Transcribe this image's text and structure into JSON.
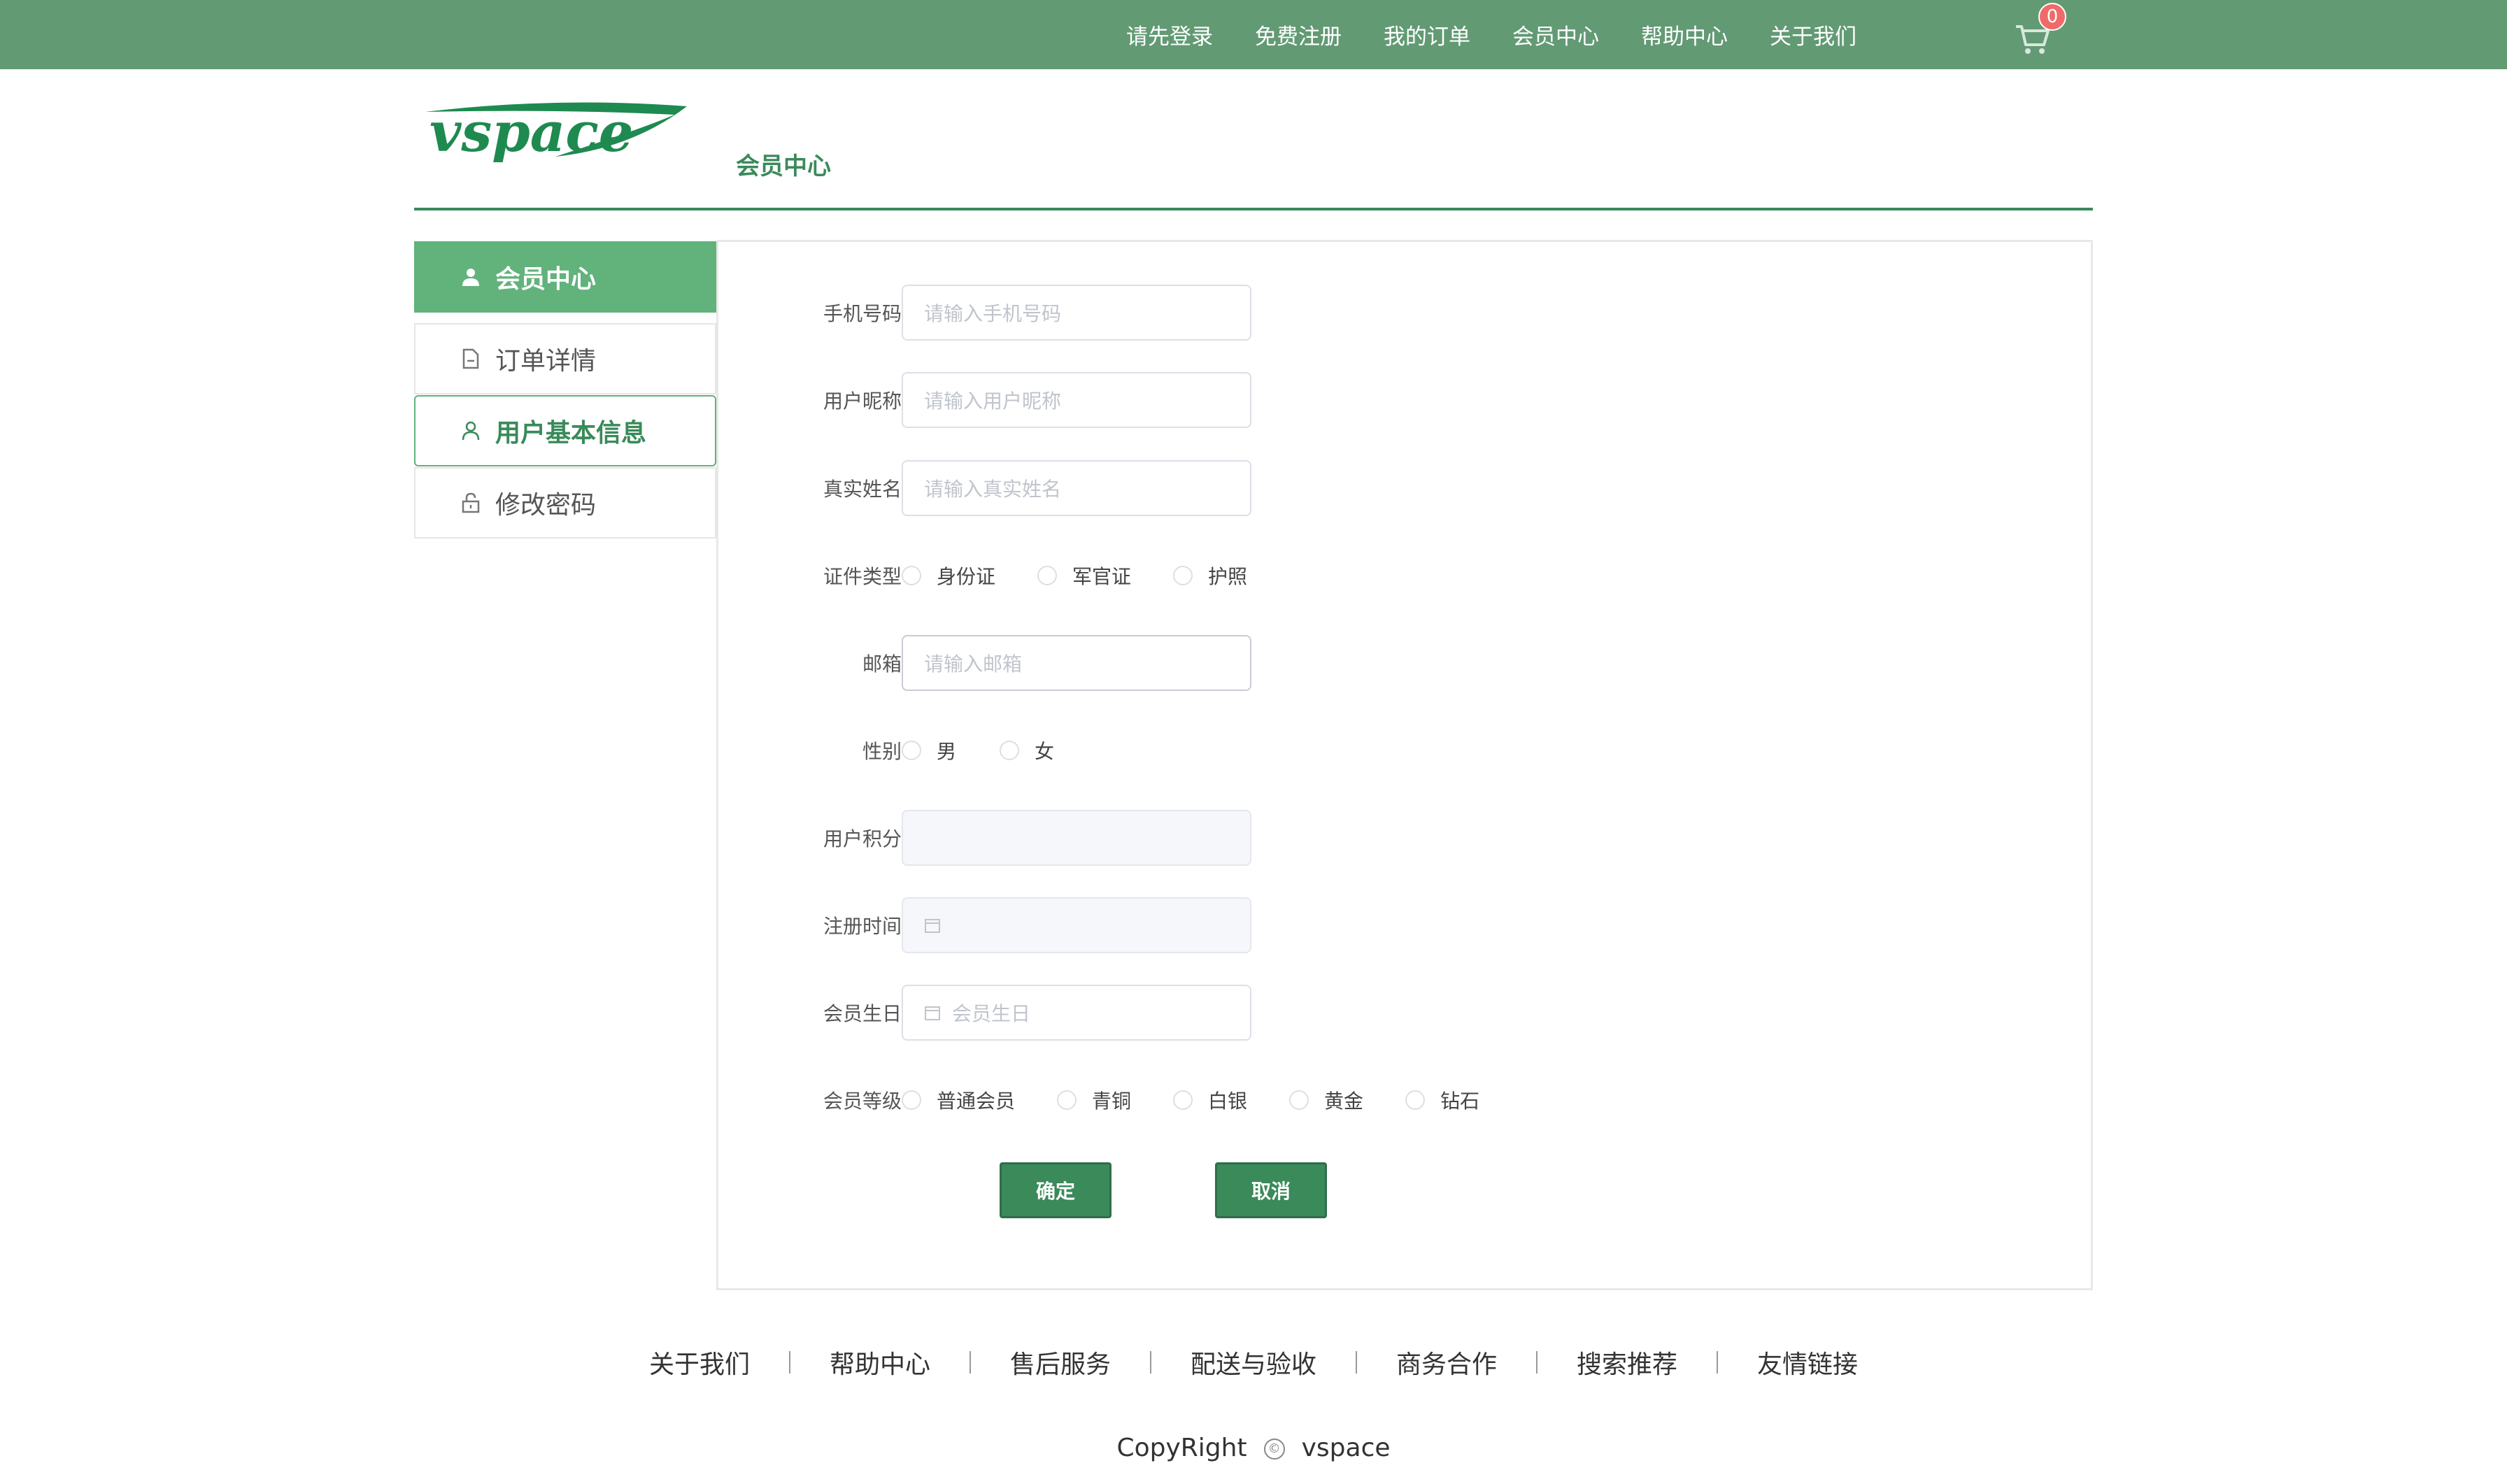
{
  "topnav": {
    "items": [
      "请先登录",
      "免费注册",
      "我的订单",
      "会员中心",
      "帮助中心",
      "关于我们"
    ],
    "cart_count": "0"
  },
  "header": {
    "logo_text": "vspace",
    "title": "会员中心"
  },
  "sidebar": {
    "items": [
      {
        "label": "会员中心",
        "icon": "user-filled-icon"
      },
      {
        "label": "订单详情",
        "icon": "document-icon"
      },
      {
        "label": "用户基本信息",
        "icon": "user-icon"
      },
      {
        "label": "修改密码",
        "icon": "lock-icon"
      }
    ]
  },
  "form": {
    "phone": {
      "label": "手机号码",
      "placeholder": "请输入手机号码"
    },
    "nickname": {
      "label": "用户昵称",
      "placeholder": "请输入用户昵称"
    },
    "realname": {
      "label": "真实姓名",
      "placeholder": "请输入真实姓名"
    },
    "id_type": {
      "label": "证件类型",
      "options": [
        "身份证",
        "军官证",
        "护照"
      ]
    },
    "email": {
      "label": "邮箱",
      "placeholder": "请输入邮箱"
    },
    "gender": {
      "label": "性别",
      "options": [
        "男",
        "女"
      ]
    },
    "points": {
      "label": "用户积分",
      "value": ""
    },
    "reg_time": {
      "label": "注册时间",
      "value": ""
    },
    "birthday": {
      "label": "会员生日",
      "placeholder": "会员生日"
    },
    "level": {
      "label": "会员等级",
      "options": [
        "普通会员",
        "青铜",
        "白银",
        "黄金",
        "钻石"
      ]
    },
    "confirm_label": "确定",
    "cancel_label": "取消"
  },
  "footer": {
    "links": [
      "关于我们",
      "帮助中心",
      "售后服务",
      "配送与验收",
      "商务合作",
      "搜索推荐",
      "友情链接"
    ],
    "copyright_left": "CopyRight",
    "copyright_symbol": "©",
    "copyright_right": "vspace"
  },
  "colors": {
    "topbar": "#629a74",
    "accent": "#3a8a5a",
    "sidebar_active": "#62b27c"
  }
}
